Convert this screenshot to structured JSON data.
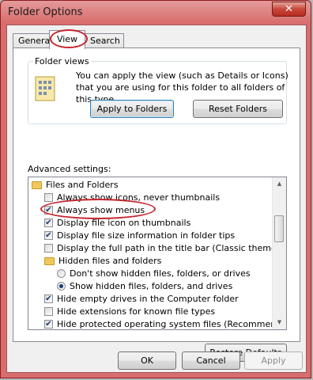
{
  "window": {
    "title": "Folder Options",
    "close_glyph": "✕"
  },
  "tabs": [
    "General",
    "View",
    "Search"
  ],
  "folder_views": {
    "label": "Folder views",
    "description": "You can apply the view (such as Details or Icons) that you are using for this folder to all folders of this type.",
    "apply_button": "Apply to Folders",
    "reset_button": "Reset Folders"
  },
  "advanced": {
    "label": "Advanced settings:",
    "items": [
      {
        "type": "folder",
        "label": "Files and Folders",
        "level": 0
      },
      {
        "type": "checkbox",
        "label": "Always show icons, never thumbnails",
        "checked": false,
        "level": 1
      },
      {
        "type": "checkbox",
        "label": "Always show menus",
        "checked": true,
        "level": 1
      },
      {
        "type": "checkbox",
        "label": "Display file icon on thumbnails",
        "checked": true,
        "level": 1
      },
      {
        "type": "checkbox",
        "label": "Display file size information in folder tips",
        "checked": true,
        "level": 1
      },
      {
        "type": "checkbox",
        "label": "Display the full path in the title bar (Classic theme only)",
        "checked": false,
        "level": 1
      },
      {
        "type": "folder",
        "label": "Hidden files and folders",
        "level": 1
      },
      {
        "type": "radio",
        "label": "Don't show hidden files, folders, or drives",
        "checked": false,
        "level": 2
      },
      {
        "type": "radio",
        "label": "Show hidden files, folders, and drives",
        "checked": true,
        "level": 2
      },
      {
        "type": "checkbox",
        "label": "Hide empty drives in the Computer folder",
        "checked": true,
        "level": 1
      },
      {
        "type": "checkbox",
        "label": "Hide extensions for known file types",
        "checked": false,
        "level": 1
      },
      {
        "type": "checkbox",
        "label": "Hide protected operating system files (Recommended)",
        "checked": true,
        "level": 1
      }
    ],
    "restore_button": "Restore Defaults"
  },
  "footer": {
    "ok": "OK",
    "cancel": "Cancel",
    "apply": "Apply"
  },
  "icons": {
    "checkmark": "✔",
    "scroll_up": "▲",
    "scroll_down": "▼"
  },
  "colors": {
    "highlight_ellipse": "#c4262e"
  }
}
